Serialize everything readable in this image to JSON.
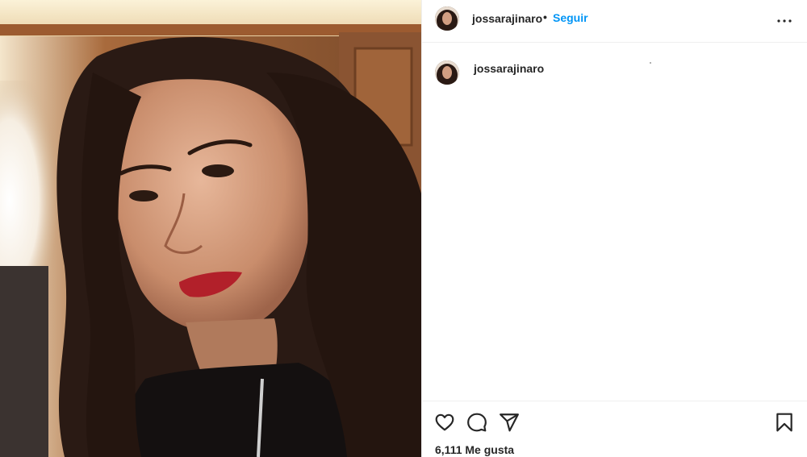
{
  "post": {
    "username": "jossarajinaro",
    "separator": "•",
    "follow_label": "Seguir",
    "caption_username": "jossarajinaro",
    "likes_text": "6,111 Me gusta"
  },
  "icons": {
    "more": "more-options-icon",
    "like": "heart-icon",
    "comment": "comment-icon",
    "share": "paper-plane-icon",
    "save": "bookmark-icon"
  },
  "colors": {
    "accent": "#0095f6",
    "text": "#262626",
    "divider": "#efefef"
  }
}
